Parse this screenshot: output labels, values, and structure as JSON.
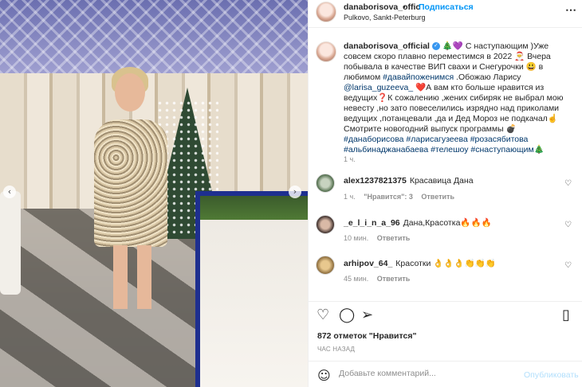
{
  "post": {
    "username": "danaborisova_offic",
    "dot": "•",
    "follow_label": "Подписаться",
    "location": "Pulkovo, Sankt-Peterburg",
    "more_icon": "ellipsis-icon"
  },
  "caption": {
    "username": "danaborisova_official",
    "verified_icon": "verified-badge-icon",
    "text_part1": " 🎄💜 С наступающим )Уже совсем скоро плавно переместимся в 2022 🎅 Вчера побывала в качестве ВИП свахи и Снегурочки 😃 в любимом ",
    "tag1": "#давайпоженимся",
    "text_part2": " .Обожаю Ларису ",
    "mention": "@larisa_guzeeva_",
    "text_part3": " ❤️А вам кто больше нравится из ведущих❓К сожалению ,жених сибиряк не выбрал мою невесту ,но зато повеселились изрядно над приколами ведущих ,потанцевали ,да и Дед Мороз не подкачал☝️Смотрите новогодний выпуск программы 💣 ",
    "tags": "#данаборисова #ларисагузеева #розасябитова #альбинаджанабаева #телешоу #снаступающим🎄",
    "time": "1 ч."
  },
  "comments": [
    {
      "username": "alex1237821375",
      "text": "Красавица Дана",
      "time": "1 ч.",
      "likes": "\"Нравится\": 3",
      "reply": "Ответить"
    },
    {
      "username": "_e_l_i_n_a_96",
      "text": "Дана,Красотка🔥🔥🔥",
      "time": "10 мин.",
      "likes": "",
      "reply": "Ответить"
    },
    {
      "username": "arhipov_64_",
      "text": "Красотки 👌👌👌👏👏👏",
      "time": "45 мин.",
      "likes": "",
      "reply": "Ответить"
    }
  ],
  "actions": {
    "like_icon": "heart-icon",
    "comment_icon": "comment-icon",
    "share_icon": "paper-plane-icon",
    "save_icon": "bookmark-icon"
  },
  "likes_text": "872 отметок \"Нравится\"",
  "posted_ago": "ЧАС НАЗАД",
  "add_comment": {
    "placeholder": "Добавьте комментарий...",
    "publish_label": "Опубликовать",
    "emoji_icon": "smiley-icon"
  },
  "colors": {
    "link_blue": "#0095f6",
    "tag_blue": "#00376b",
    "muted": "#8e8e8e",
    "publish_disabled": "#b2dffc"
  }
}
